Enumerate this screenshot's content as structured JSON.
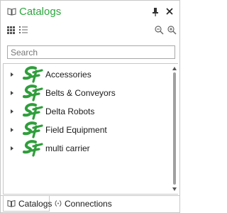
{
  "panel": {
    "title": "Catalogs",
    "title_icon": "open-book-icon",
    "pin_icon": "pin-icon",
    "close_icon": "close-icon"
  },
  "toolbar": {
    "grid_view_icon": "grid-view-icon",
    "list_view_icon": "list-view-icon",
    "zoom_out_icon": "zoom-out-icon",
    "zoom_in_icon": "zoom-in-icon"
  },
  "search": {
    "placeholder": "Search",
    "value": ""
  },
  "tree": {
    "items": [
      {
        "label": "Accessories"
      },
      {
        "label": "Belts & Conveyors"
      },
      {
        "label": "Delta Robots"
      },
      {
        "label": "Field Equipment"
      },
      {
        "label": "multi carrier"
      }
    ]
  },
  "tabs": [
    {
      "label": "Catalogs",
      "icon": "open-book-icon",
      "active": true
    },
    {
      "label": "Connections",
      "icon": "connections-icon",
      "active": false
    }
  ],
  "colors": {
    "accent": "#2ea63f",
    "logo_green": "#2f9e3b"
  }
}
